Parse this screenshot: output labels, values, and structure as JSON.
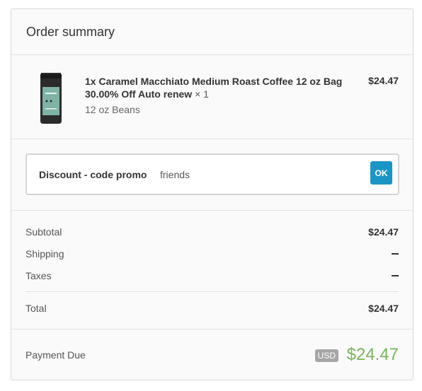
{
  "summary": {
    "title": "Order summary"
  },
  "item": {
    "title_line1": "1x Caramel Macchiato Medium Roast Coffee 12 oz Bag",
    "title_line2": "30.00% Off Auto renew",
    "quantity": "× 1",
    "variant": "12 oz Beans",
    "price": "$24.47"
  },
  "discount": {
    "label": "Discount - code promo",
    "value": "friends",
    "button_label": "OK"
  },
  "totals": {
    "subtotal_label": "Subtotal",
    "subtotal_value": "$24.47",
    "shipping_label": "Shipping",
    "taxes_label": "Taxes",
    "total_label": "Total",
    "total_value": "$24.47"
  },
  "payment_due": {
    "label": "Payment Due",
    "currency": "USD",
    "amount": "$24.47"
  },
  "colors": {
    "accent_button": "#1b95c6",
    "amount_green": "#7ab55c"
  }
}
